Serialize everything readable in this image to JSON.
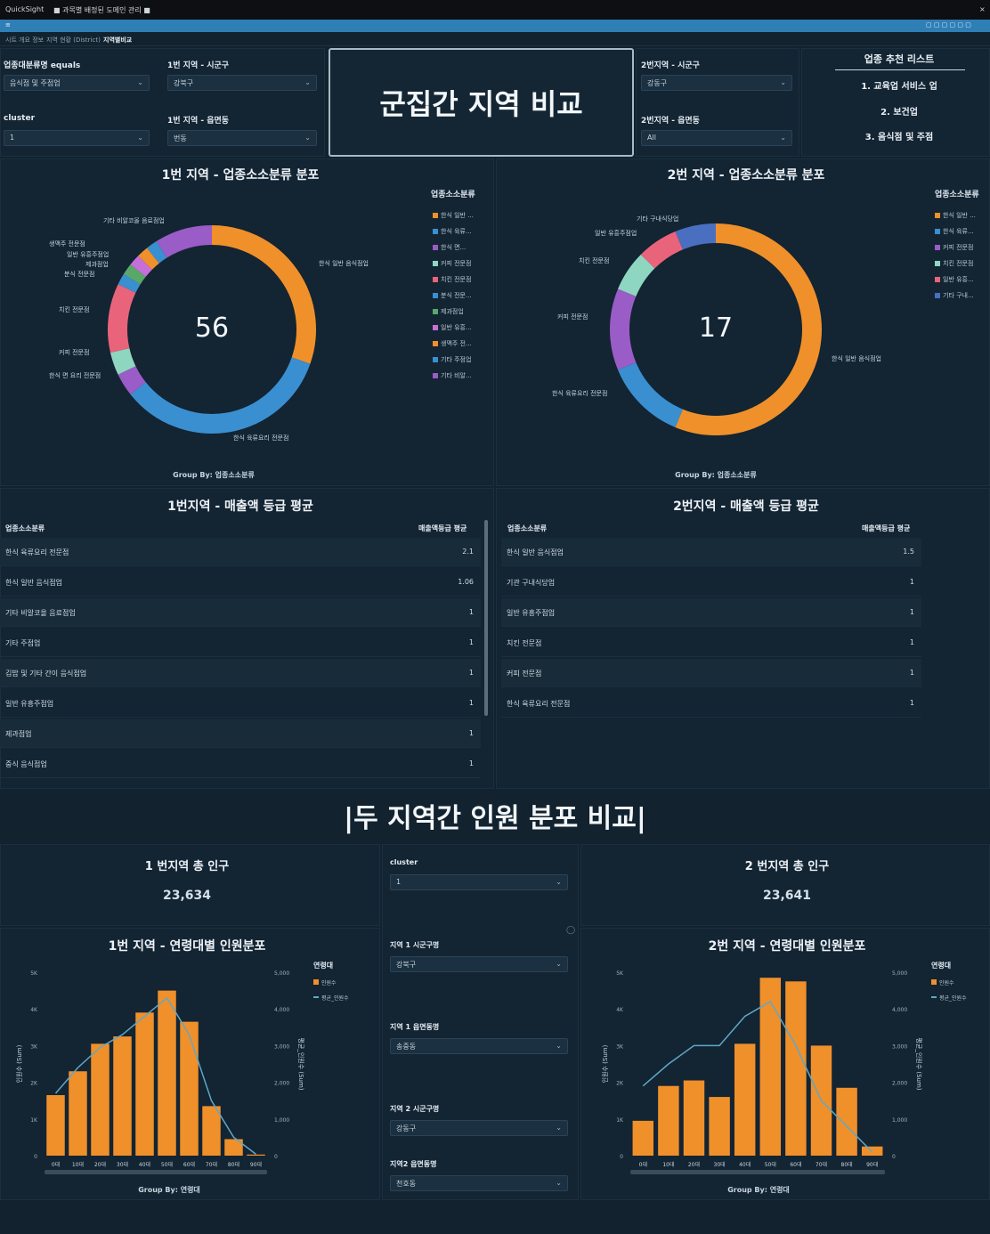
{
  "window": {
    "app_title": "QuickSight",
    "tab_text": "■ 과목별 배정된 도메인 관리 ■"
  },
  "sheet_tabs": [
    "시트 개요 정보",
    "지역 현황 (District)",
    "지역별비교"
  ],
  "filters_left": [
    {
      "label": "업종대분류명 equals",
      "value": "음식점 및 주점업"
    },
    {
      "label": "1번 지역 - 시군구",
      "value": "강북구"
    },
    {
      "label": "cluster",
      "value": "1"
    },
    {
      "label": "1번 지역 - 읍면동",
      "value": "번동"
    }
  ],
  "filters_right": [
    {
      "label": "2번지역 - 시군구",
      "value": "강동구"
    },
    {
      "label": "2번지역 - 읍면동",
      "value": "All"
    }
  ],
  "main_title": "군집간 지역 비교",
  "recommendations": {
    "title": "업종 추천 리스트",
    "items": [
      "1. 교육업 서비스 업",
      "2. 보건업",
      "3. 음식점 및 주점"
    ]
  },
  "donut1": {
    "title": "1번 지역 - 업종소소분류 분포",
    "center_value": "56",
    "group_by": "Group By: 업종소소분류",
    "legend_title": "업종소소분류",
    "legend": [
      "한식 일반 ...",
      "한식 육류...",
      "한식 면...",
      "커피 전문점",
      "치킨 전문점",
      "분식 전문...",
      "제과점업",
      "일반 유흥...",
      "생맥주 전...",
      "기타 주점업",
      "기타 비알..."
    ],
    "callouts": [
      "기타 비알코올 음료점업",
      "생맥주 전문점",
      "일반 유흥주점업",
      "제과점업",
      "분식 전문점",
      "치킨 전문점",
      "커피 전문점",
      "한식 면 요리 전문점",
      "한식 일반 음식점업",
      "한식 육류요리 전문점"
    ]
  },
  "donut2": {
    "title": "2번 지역 - 업종소소분류 분포",
    "center_value": "17",
    "group_by": "Group By: 업종소소분류",
    "legend_title": "업종소소분류",
    "legend": [
      "한식 일반 ...",
      "한식 육류...",
      "커피 전문점",
      "치킨 전문점",
      "일반 유흥...",
      "기타 구내..."
    ],
    "callouts": [
      "기타 구내식당업",
      "일반 유흥주점업",
      "치킨 전문점",
      "커피 전문점",
      "한식 육류요리 전문점",
      "한식 일반 음식점업"
    ]
  },
  "table1": {
    "title": "1번지역 - 매출액 등급 평균",
    "col1": "업종소소분류",
    "col2": "매출액등급 평균",
    "rows": [
      {
        "name": "한식 육류요리 전문점",
        "value": "2.1"
      },
      {
        "name": "한식 일반 음식점업",
        "value": "1.06"
      },
      {
        "name": "기타 비알코올 음료점업",
        "value": "1"
      },
      {
        "name": "기타 주점업",
        "value": "1"
      },
      {
        "name": "김밥 및 기타 간이 음식점업",
        "value": "1"
      },
      {
        "name": "일반 유흥주점업",
        "value": "1"
      },
      {
        "name": "제과점업",
        "value": "1"
      },
      {
        "name": "중식 음식점업",
        "value": "1"
      }
    ]
  },
  "table2": {
    "title": "2번지역 - 매출액 등급 평균",
    "col1": "업종소소분류",
    "col2": "매출액등급 평균",
    "rows": [
      {
        "name": "한식 일반 음식점업",
        "value": "1.5"
      },
      {
        "name": "기관 구내식당업",
        "value": "1"
      },
      {
        "name": "일반 유흥주점업",
        "value": "1"
      },
      {
        "name": "치킨 전문점",
        "value": "1"
      },
      {
        "name": "커피 전문점",
        "value": "1"
      },
      {
        "name": "한식 육류요리 전문점",
        "value": "1"
      }
    ]
  },
  "section_title": "|두 지역간 인원 분포 비교|",
  "kpi1": {
    "title": "1 번지역 총 인구",
    "value": "23,634"
  },
  "kpi2": {
    "title": "2 번지역 총 인구",
    "value": "23,641"
  },
  "mid_controls": [
    {
      "label": "cluster",
      "value": "1"
    },
    {
      "label": "지역 1 시군구명",
      "value": "강북구"
    },
    {
      "label": "지역 1 읍면동명",
      "value": "송중동"
    },
    {
      "label": "지역 2 시군구명",
      "value": "강동구"
    },
    {
      "label": "지역2 읍면동명",
      "value": "천호동"
    }
  ],
  "colors": {
    "orange": "#f0902a",
    "blue": "#3a8fd0",
    "teal": "#5fa8c8",
    "background": "#12222f"
  },
  "chart_data": [
    {
      "type": "pie",
      "title": "1번 지역 - 업종소소분류 분포",
      "center_total": 56,
      "categories": [
        "한식 일반 음식점업",
        "한식 육류요리 전문점",
        "한식 면 요리 전문점",
        "커피 전문점",
        "치킨 전문점",
        "분식 전문점",
        "제과점업",
        "일반 유흥주점업",
        "생맥주 전문점",
        "기타 주점업",
        "기타 비알코올 음료점업"
      ],
      "values": [
        17,
        19,
        2,
        2,
        6,
        1,
        1,
        1,
        1,
        1,
        5
      ],
      "colors": [
        "#f0902a",
        "#3a8fd0",
        "#9a5cc6",
        "#8fd6c0",
        "#e9647a",
        "#3a8fd0",
        "#58a86a",
        "#c76fd9",
        "#f0902a",
        "#3a8fd0",
        "#9a5cc6"
      ]
    },
    {
      "type": "pie",
      "title": "2번 지역 - 업종소소분류 분포",
      "center_total": 17,
      "categories": [
        "한식 일반 음식점업",
        "한식 육류요리 전문점",
        "커피 전문점",
        "치킨 전문점",
        "일반 유흥주점업",
        "기타 구내식당업"
      ],
      "values": [
        9,
        2,
        2,
        1,
        1,
        1
      ],
      "colors": [
        "#f0902a",
        "#3a8fd0",
        "#9a5cc6",
        "#8fd6c0",
        "#e9647a",
        "#4a6fc0"
      ]
    },
    {
      "type": "bar",
      "title": "1번 지역 - 연령대별 인원분포",
      "categories": [
        "0대",
        "10대",
        "20대",
        "30대",
        "40대",
        "50대",
        "60대",
        "70대",
        "80대",
        "90대"
      ],
      "series": [
        {
          "name": "인원수",
          "values": [
            1650,
            2300,
            3050,
            3250,
            3900,
            4500,
            3650,
            1350,
            450,
            30
          ]
        },
        {
          "name": "평균_인원수",
          "values": [
            1700,
            2400,
            2950,
            3300,
            3800,
            4300,
            3300,
            1500,
            500,
            40
          ]
        }
      ],
      "legend_title": "연령대",
      "ylabel": "인원수 (Sum)",
      "y2label": "평균_인원수 (Sum)",
      "xlabel": "Group By: 연령대",
      "ylim": [
        0,
        5000
      ],
      "y2lim": [
        0,
        5000
      ],
      "y_ticks": [
        "0",
        "1K",
        "2K",
        "3K",
        "4K",
        "5K"
      ],
      "y2_ticks": [
        "0",
        "1,000",
        "2,000",
        "3,000",
        "4,000",
        "5,000"
      ]
    },
    {
      "type": "bar",
      "title": "2번 지역 - 연령대별 인원분포",
      "categories": [
        "0대",
        "10대",
        "20대",
        "30대",
        "40대",
        "50대",
        "60대",
        "70대",
        "80대",
        "90대"
      ],
      "series": [
        {
          "name": "인원수",
          "values": [
            950,
            1900,
            2050,
            1600,
            3050,
            4850,
            4750,
            3000,
            1850,
            250
          ]
        },
        {
          "name": "평균_인원수",
          "values": [
            1900,
            2500,
            3000,
            3000,
            3800,
            4200,
            3000,
            1500,
            800,
            100
          ]
        }
      ],
      "legend_title": "연령대",
      "ylabel": "인원수 (Sum)",
      "y2label": "평균_인원수 (Sum)",
      "xlabel": "Group By: 연령대",
      "ylim": [
        0,
        5000
      ],
      "y2lim": [
        0,
        5000
      ],
      "y_ticks": [
        "0",
        "1K",
        "2K",
        "3K",
        "4K",
        "5K"
      ],
      "y2_ticks": [
        "0",
        "1,000",
        "2,000",
        "3,000",
        "4,000",
        "5,000"
      ]
    }
  ]
}
